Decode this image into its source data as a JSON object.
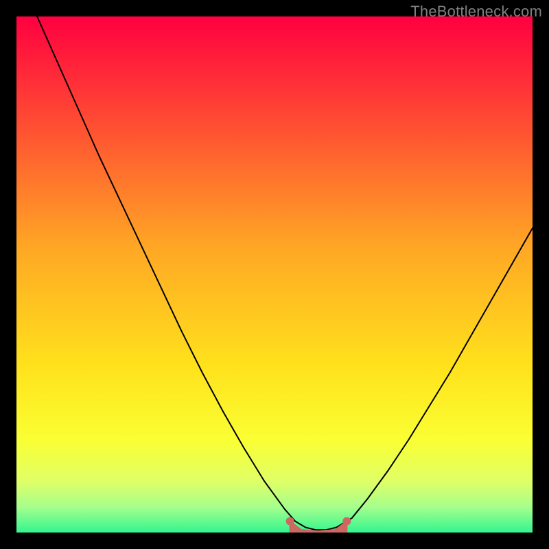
{
  "watermark": "TheBottleneck.com",
  "chart_data": {
    "type": "line",
    "title": "",
    "xlabel": "",
    "ylabel": "",
    "xlim": [
      0,
      100
    ],
    "ylim": [
      0,
      100
    ],
    "gradient_stops": [
      {
        "offset": 0,
        "color": "#ff0040"
      },
      {
        "offset": 20,
        "color": "#ff4a33"
      },
      {
        "offset": 45,
        "color": "#ffa824"
      },
      {
        "offset": 68,
        "color": "#ffe21c"
      },
      {
        "offset": 82,
        "color": "#faff33"
      },
      {
        "offset": 90,
        "color": "#e0ff66"
      },
      {
        "offset": 95,
        "color": "#a6ff8c"
      },
      {
        "offset": 100,
        "color": "#33f58f"
      }
    ],
    "series": [
      {
        "name": "bottleneck-curve",
        "x": [
          4,
          8,
          12,
          16,
          20,
          24,
          28,
          32,
          36,
          40,
          44,
          48,
          52,
          54,
          56,
          58,
          60,
          62,
          65,
          68,
          72,
          76,
          80,
          84,
          88,
          92,
          96,
          100
        ],
        "y": [
          100,
          91,
          82,
          73,
          64.5,
          56,
          47.5,
          39,
          31,
          23.5,
          16.5,
          10,
          4.5,
          2.2,
          1.0,
          0.5,
          0.5,
          1.0,
          2.8,
          6.5,
          12,
          18,
          24.5,
          31,
          38,
          45,
          52,
          59
        ]
      }
    ],
    "optimum_band": {
      "x_start": 53,
      "x_end": 64,
      "height": 2.2
    },
    "annotations": []
  }
}
